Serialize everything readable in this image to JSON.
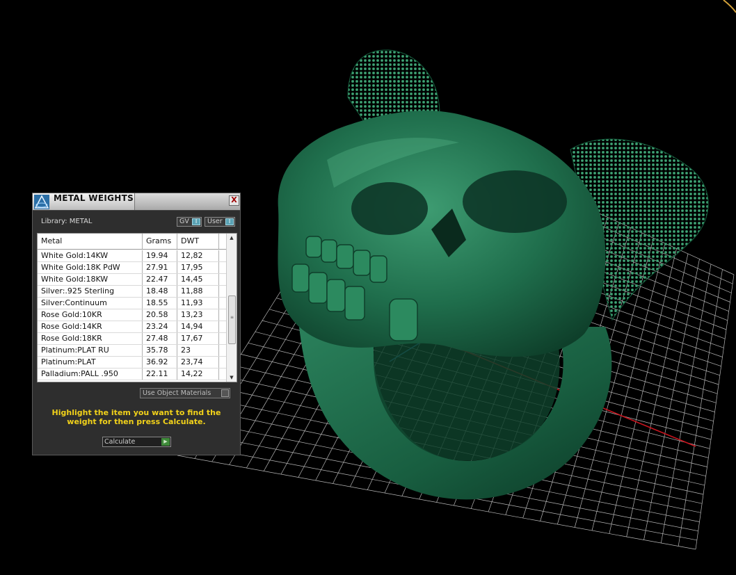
{
  "panel": {
    "title": "METAL WEIGHTS",
    "close_label": "X",
    "library_label": "Library: METAL",
    "toggle_gv_label": "GV",
    "toggle_user_label": "User",
    "toggle_indicator": "I",
    "columns": [
      "Metal",
      "Grams",
      "DWT"
    ],
    "rows": [
      {
        "metal": "White Gold:14KW",
        "grams": "19.94",
        "dwt": "12,82"
      },
      {
        "metal": "White Gold:18K PdW",
        "grams": "27.91",
        "dwt": "17,95"
      },
      {
        "metal": "White Gold:18KW",
        "grams": "22.47",
        "dwt": "14,45"
      },
      {
        "metal": "Silver:.925 Sterling",
        "grams": "18.48",
        "dwt": "11,88"
      },
      {
        "metal": "Silver:Continuum",
        "grams": "18.55",
        "dwt": "11,93"
      },
      {
        "metal": "Rose Gold:10KR",
        "grams": "20.58",
        "dwt": "13,23"
      },
      {
        "metal": "Rose Gold:14KR",
        "grams": "23.24",
        "dwt": "14,94"
      },
      {
        "metal": "Rose Gold:18KR",
        "grams": "27.48",
        "dwt": "17,67"
      },
      {
        "metal": "Platinum:PLAT RU",
        "grams": "35.78",
        "dwt": "23"
      },
      {
        "metal": "Platinum:PLAT",
        "grams": "36.92",
        "dwt": "23,74"
      },
      {
        "metal": "Palladium:PALL .950",
        "grams": "22.11",
        "dwt": "14,22"
      }
    ],
    "use_object_materials_label": "Use Object Materials",
    "hint_text": "Highlight the item you want to find the weight for then press Calculate.",
    "calculate_label": "Calculate"
  },
  "colors": {
    "background": "#000000",
    "grid": "#d9d9d9",
    "axis_x": "#c8141e",
    "axis_y": "#3a8fd0",
    "model": "#1d6b4a",
    "hint": "#f2d21a"
  },
  "icons": {
    "logo": "triangle-logo-icon",
    "close": "close-icon",
    "scroll_up": "chevron-up-icon",
    "scroll_down": "chevron-down-icon",
    "calculate": "play-arrow-icon"
  }
}
